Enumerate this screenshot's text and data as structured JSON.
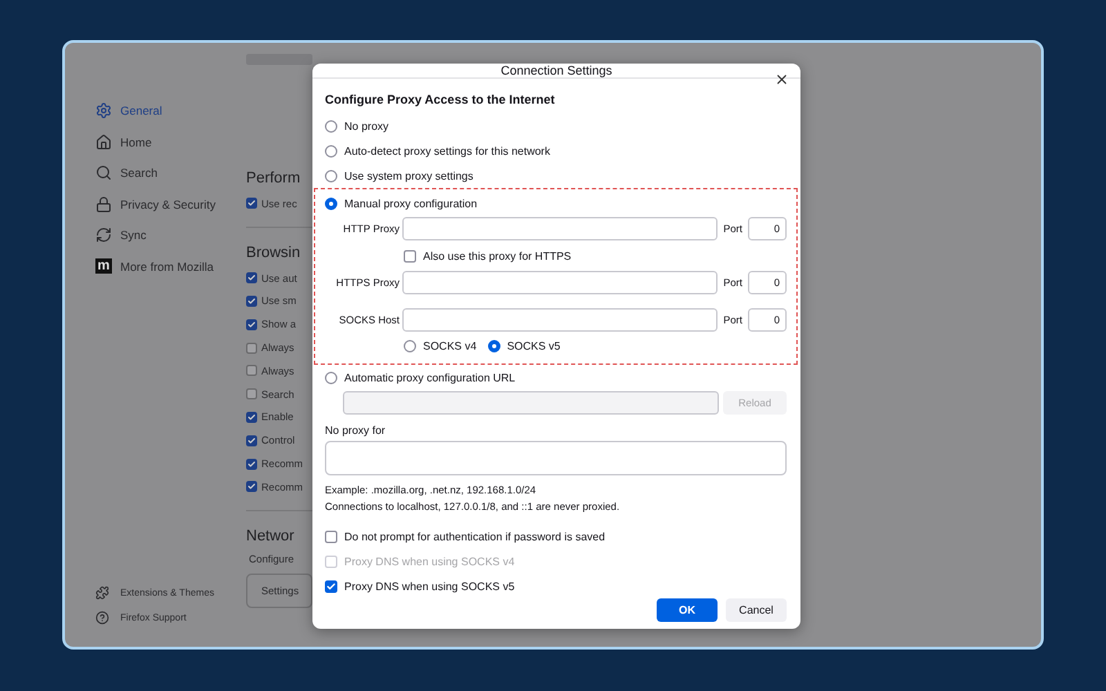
{
  "sidebar": {
    "items": [
      {
        "label": "General",
        "selected": true
      },
      {
        "label": "Home",
        "selected": false
      },
      {
        "label": "Search",
        "selected": false
      },
      {
        "label": "Privacy & Security",
        "selected": false
      },
      {
        "label": "Sync",
        "selected": false
      },
      {
        "label": "More from Mozilla",
        "selected": false,
        "logo": "m"
      }
    ],
    "footer": [
      {
        "label": "Extensions & Themes"
      },
      {
        "label": "Firefox Support"
      }
    ]
  },
  "background": {
    "sections": [
      {
        "heading": "Perform",
        "options": [
          {
            "label": "Use rec",
            "checked": true
          }
        ]
      },
      {
        "heading": "Browsin",
        "options": [
          {
            "label": "Use aut",
            "checked": true
          },
          {
            "label": "Use sm",
            "checked": true
          },
          {
            "label": "Show a",
            "checked": true
          },
          {
            "label": "Always",
            "checked": false
          },
          {
            "label": "Always",
            "checked": false
          },
          {
            "label": "Search",
            "checked": false
          },
          {
            "label": "Enable",
            "checked": true
          },
          {
            "label": "Control",
            "checked": true
          },
          {
            "label": "Recomm",
            "checked": true
          },
          {
            "label": "Recomm",
            "checked": true
          }
        ]
      },
      {
        "heading": "Networ",
        "text": "Configure",
        "button": "Settings"
      }
    ]
  },
  "dialog": {
    "title": "Connection Settings",
    "heading": "Configure Proxy Access to the Internet",
    "modes": [
      {
        "kind": "plain",
        "label": "No proxy",
        "selected": false
      },
      {
        "kind": "plain",
        "label": "Auto-detect proxy settings for this network",
        "selected": false
      },
      {
        "kind": "plain",
        "label": "Use system proxy settings",
        "selected": false
      },
      {
        "kind": "manual",
        "label": "Manual proxy configuration",
        "selected": true,
        "highlighted": true
      },
      {
        "kind": "pac",
        "label": "Automatic proxy configuration URL",
        "selected": false,
        "button": "Reload",
        "disabled": true
      }
    ],
    "proxies": [
      {
        "label": "HTTP Proxy",
        "port_label": "Port",
        "port": "0"
      },
      {
        "label": "HTTPS Proxy",
        "port_label": "Port",
        "port": "0"
      },
      {
        "label": "SOCKS Host",
        "port_label": "Port",
        "port": "0"
      }
    ],
    "https_share": {
      "label": "Also use this proxy for HTTPS",
      "checked": false
    },
    "socks_versions": [
      {
        "label": "SOCKS v4",
        "selected": false
      },
      {
        "label": "SOCKS v5",
        "selected": true
      }
    ],
    "no_proxy_label": "No proxy for",
    "notes": [
      "Example: .mozilla.org, .net.nz, 192.168.1.0/24",
      "Connections to localhost, 127.0.0.1/8, and ::1 are never proxied."
    ],
    "options": [
      {
        "label": "Do not prompt for authentication if password is saved",
        "checked": false,
        "disabled": false
      },
      {
        "label": "Proxy DNS when using SOCKS v4",
        "checked": false,
        "disabled": true
      },
      {
        "label": "Proxy DNS when using SOCKS v5",
        "checked": true,
        "disabled": false
      }
    ],
    "buttons": [
      {
        "label": "OK",
        "primary": true
      },
      {
        "label": "Cancel",
        "primary": false
      }
    ]
  }
}
